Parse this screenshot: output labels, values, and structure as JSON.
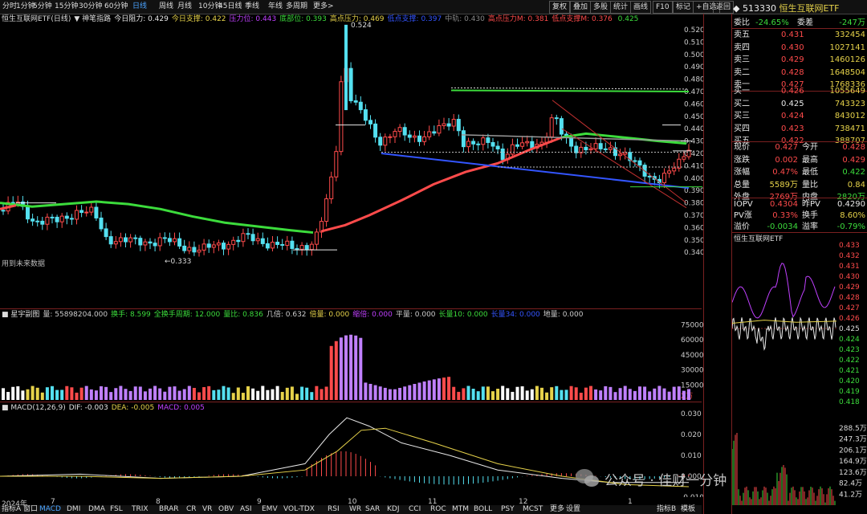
{
  "toolbar": {
    "periods": [
      "分时",
      "1分钟",
      "5分钟",
      "15分钟",
      "30分钟",
      "60分钟",
      "日线",
      "周线",
      "月线",
      "10分钟",
      "45日线",
      "季线",
      "年线",
      "多周期",
      "更多>"
    ],
    "active_period": "日线",
    "right_buttons": [
      "复权",
      "叠加",
      "多股",
      "统计",
      "画线",
      "F10",
      "标记",
      "+自选",
      "返回"
    ]
  },
  "main_panel": {
    "title": "恒生互联网ETF(日线)",
    "indicator_name": "神笔指路",
    "items": [
      {
        "label": "今日阻力:",
        "value": "0.429",
        "color": "#e8e8e8"
      },
      {
        "label": "今日支撑:",
        "value": "0.422",
        "color": "#e6d24a"
      },
      {
        "label": "压力位:",
        "value": "0.443",
        "color": "#c040ff"
      },
      {
        "label": "底部位:",
        "value": "0.393",
        "color": "#3cdc3c"
      },
      {
        "label": "高点压力:",
        "value": "0.469",
        "color": "#e6d24a"
      },
      {
        "label": "低点支撑:",
        "value": "0.397",
        "color": "#3355ff"
      },
      {
        "label": "中轨:",
        "value": "0.430",
        "color": "#888888"
      },
      {
        "label": "高点压力M:",
        "value": "0.381",
        "color": "#ff4b4b"
      },
      {
        "label": "低点支撑M:",
        "value": "0.376",
        "color": "#ff4b4b"
      },
      {
        "label": "",
        "value": "0.425",
        "color": "#3cdc3c"
      }
    ],
    "peak_label": "0.524",
    "low_label": "0.333",
    "bottom_note": "用到未来数据",
    "y_axis": [
      "0.520",
      "0.510",
      "0.500",
      "0.490",
      "0.480",
      "0.470",
      "0.460",
      "0.450",
      "0.440",
      "0.430",
      "0.420",
      "0.410",
      "0.400",
      "0.390",
      "0.380",
      "0.370",
      "0.360",
      "0.350",
      "0.340"
    ]
  },
  "volume_panel": {
    "title": "星宇副图",
    "items": [
      {
        "label": "量:",
        "value": "55898204.000",
        "color": "#cccccc"
      },
      {
        "label": "换手:",
        "value": "8.599",
        "color": "#3cdc3c"
      },
      {
        "label": "全换手周期:",
        "value": "12.000",
        "color": "#3cdc3c"
      },
      {
        "label": "量比:",
        "value": "0.836",
        "color": "#3cdc3c"
      },
      {
        "label": "几倍:",
        "value": "0.632",
        "color": "#cccccc"
      },
      {
        "label": "倍量:",
        "value": "0.000",
        "color": "#e6d24a"
      },
      {
        "label": "缩倍:",
        "value": "0.000",
        "color": "#c040ff"
      },
      {
        "label": "平量:",
        "value": "0.000",
        "color": "#cccccc"
      },
      {
        "label": "长量10:",
        "value": "0.000",
        "color": "#3cdc3c"
      },
      {
        "label": "长量34:",
        "value": "0.000",
        "color": "#3355ff"
      },
      {
        "label": "地量:",
        "value": "0.000",
        "color": "#cccccc"
      }
    ],
    "y_axis": [
      "75000",
      "60000",
      "45000",
      "30000",
      "15000"
    ],
    "unit": "X万"
  },
  "macd_panel": {
    "title": "MACD(12,26,9)",
    "items": [
      {
        "label": "DIF:",
        "value": "-0.003",
        "color": "#e8e8e8"
      },
      {
        "label": "DEA:",
        "value": "-0.005",
        "color": "#e6d24a"
      },
      {
        "label": "MACD:",
        "value": "0.005",
        "color": "#c040ff"
      }
    ],
    "y_axis": [
      "0.030",
      "0.020",
      "0.010",
      "0.000",
      "-0.010"
    ]
  },
  "dates": [
    "2024年",
    "7",
    "8",
    "9",
    "10",
    "11",
    "12",
    "1"
  ],
  "bottom_tabs": [
    "指标A",
    "窗口",
    "MACD",
    "DMI",
    "DMA",
    "FSL",
    "TRIX",
    "BRAR",
    "CR",
    "VR",
    "OBV",
    "ASI",
    "EMV",
    "VOL-TDX",
    "RSI",
    "WR",
    "SAR",
    "KDJ",
    "CCI",
    "ROC",
    "MTM",
    "BOLL",
    "PSY",
    "MCST",
    "更多",
    "设置"
  ],
  "bottom_right_tabs": [
    "指标B",
    "模板"
  ],
  "quote": {
    "code": "513330",
    "name": "恒生互联网ETF",
    "wb_label": "委比",
    "wb_value": "-24.65%",
    "wc_label": "委差",
    "wc_value": "-247万",
    "asks": [
      {
        "label": "卖五",
        "price": "0.431",
        "vol": "332454"
      },
      {
        "label": "卖四",
        "price": "0.430",
        "vol": "1027141"
      },
      {
        "label": "卖三",
        "price": "0.429",
        "vol": "1460126"
      },
      {
        "label": "卖二",
        "price": "0.428",
        "vol": "1648504"
      },
      {
        "label": "卖一",
        "price": "0.427",
        "vol": "1768336"
      }
    ],
    "bids": [
      {
        "label": "买一",
        "price": "0.426",
        "vol": "1055649"
      },
      {
        "label": "买二",
        "price": "0.425",
        "vol": "743323"
      },
      {
        "label": "买三",
        "price": "0.424",
        "vol": "843012"
      },
      {
        "label": "买四",
        "price": "0.423",
        "vol": "738471"
      },
      {
        "label": "买五",
        "price": "0.422",
        "vol": "388707"
      }
    ],
    "stats": [
      {
        "l1": "现价",
        "v1": "0.427",
        "c1": "r",
        "l2": "今开",
        "v2": "0.428",
        "c2": "r"
      },
      {
        "l1": "涨跌",
        "v1": "0.002",
        "c1": "r",
        "l2": "最高",
        "v2": "0.429",
        "c2": "r"
      },
      {
        "l1": "涨幅",
        "v1": "0.47%",
        "c1": "r",
        "l2": "最低",
        "v2": "0.422",
        "c2": "g"
      },
      {
        "l1": "总量",
        "v1": "5589万",
        "c1": "y",
        "l2": "量比",
        "v2": "0.84",
        "c2": "y"
      },
      {
        "l1": "外盘",
        "v1": "2769万",
        "c1": "r",
        "l2": "内盘",
        "v2": "2820万",
        "c2": "g"
      }
    ],
    "iopv": [
      {
        "l1": "IOPV",
        "v1": "0.4304",
        "c1": "r",
        "l2": "昨PV",
        "v2": "0.4290",
        "c2": "w"
      },
      {
        "l1": "PV涨",
        "v1": "0.33%",
        "c1": "r",
        "l2": "换手",
        "v2": "8.60%",
        "c2": "y"
      },
      {
        "l1": "溢价",
        "v1": "-0.0034",
        "c1": "g",
        "l2": "溢率",
        "v2": "-0.79%",
        "c2": "g"
      }
    ],
    "mini_title": "恒生互联网ETF",
    "mini_price_axis": [
      "0.433",
      "0.432",
      "0.431",
      "0.430",
      "0.429",
      "0.428",
      "0.427",
      "0.426",
      "0.425",
      "0.424",
      "0.423",
      "0.422",
      "0.421",
      "0.420",
      "0.419",
      "0.418"
    ],
    "mini_vol_axis": [
      "288.5万",
      "247.3万",
      "206.1万",
      "164.9万",
      "123.6万",
      "82.4万",
      "41.2万"
    ]
  },
  "watermark": "公众号 · 佳财一分钟"
}
